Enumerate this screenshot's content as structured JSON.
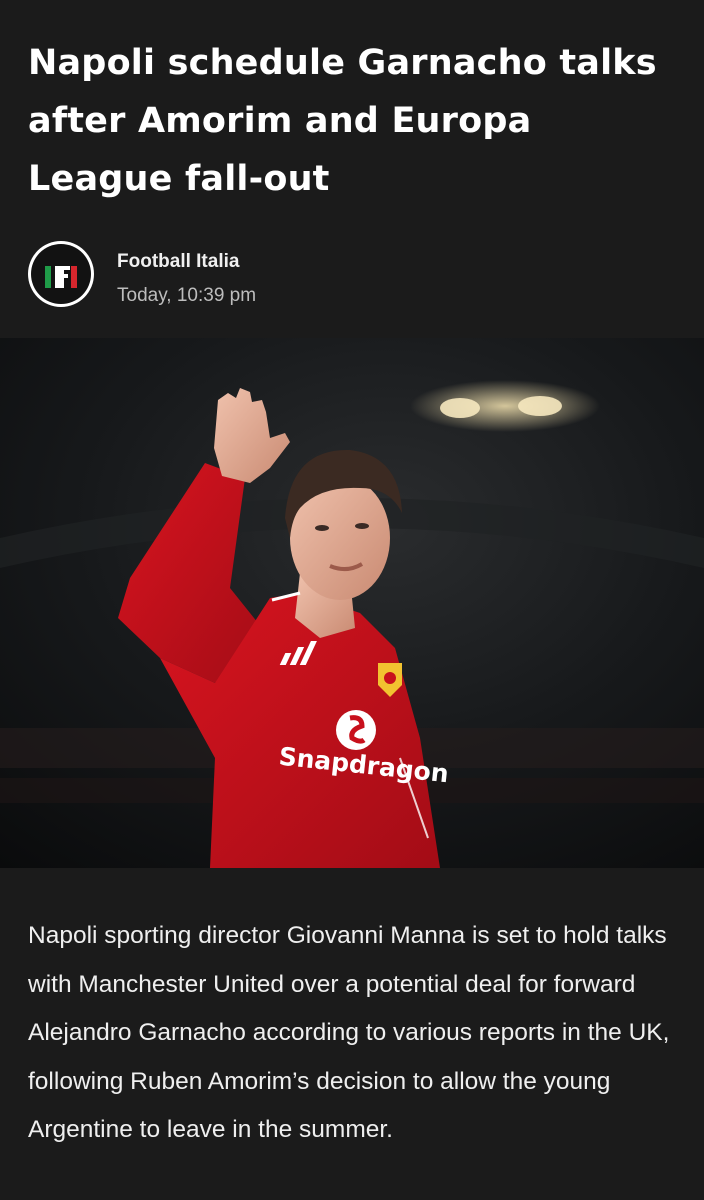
{
  "article": {
    "headline": "Napoli schedule Garnacho talks after Amorim and Europa League fall-out",
    "source": {
      "name": "Football Italia",
      "time": "Today, 10:39 pm",
      "logo_letters": "FI",
      "logo_colors": [
        "#1f9b48",
        "#ffffff",
        "#d6262d"
      ]
    },
    "image": {
      "shirt_sponsor": "Snapdragon",
      "description_icon": "player-waving-photo"
    },
    "body": "Napoli sporting director Giovanni Manna is set to hold talks with Manchester United over a potential deal for forward Alejandro Garnacho according to various reports in the UK, following Ruben Amorim’s decision to allow the young Argentine to leave in the summer."
  },
  "colors": {
    "background": "#1b1b1b",
    "shirt_red": "#c8101c",
    "text": "#efefef"
  }
}
